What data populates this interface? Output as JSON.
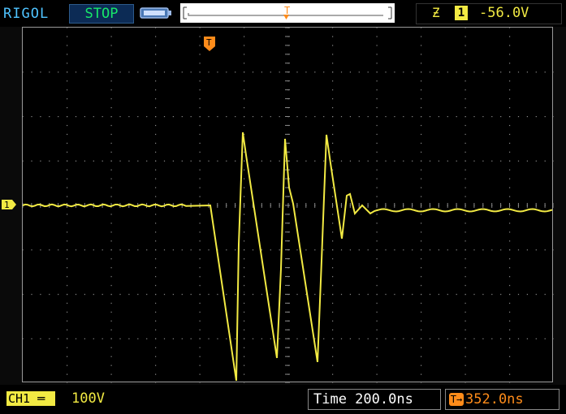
{
  "header": {
    "brand": "RIGOL",
    "run_status": "STOP",
    "trigger": {
      "edge_icon": "rising-edge-icon",
      "channel": "1",
      "level": "-56.0V"
    }
  },
  "markers": {
    "channel_marker": "1",
    "trigger_marker": "T"
  },
  "footer": {
    "ch1_label": "CH1",
    "ch1_scale": "100V",
    "time_label": "Time 200.0ns",
    "trigger_offset": "352.0ns"
  },
  "colors": {
    "trace": "#f2ea43",
    "status": "#17e86a",
    "brand": "#4fc3ff",
    "trigger": "#ff8c1a"
  }
}
